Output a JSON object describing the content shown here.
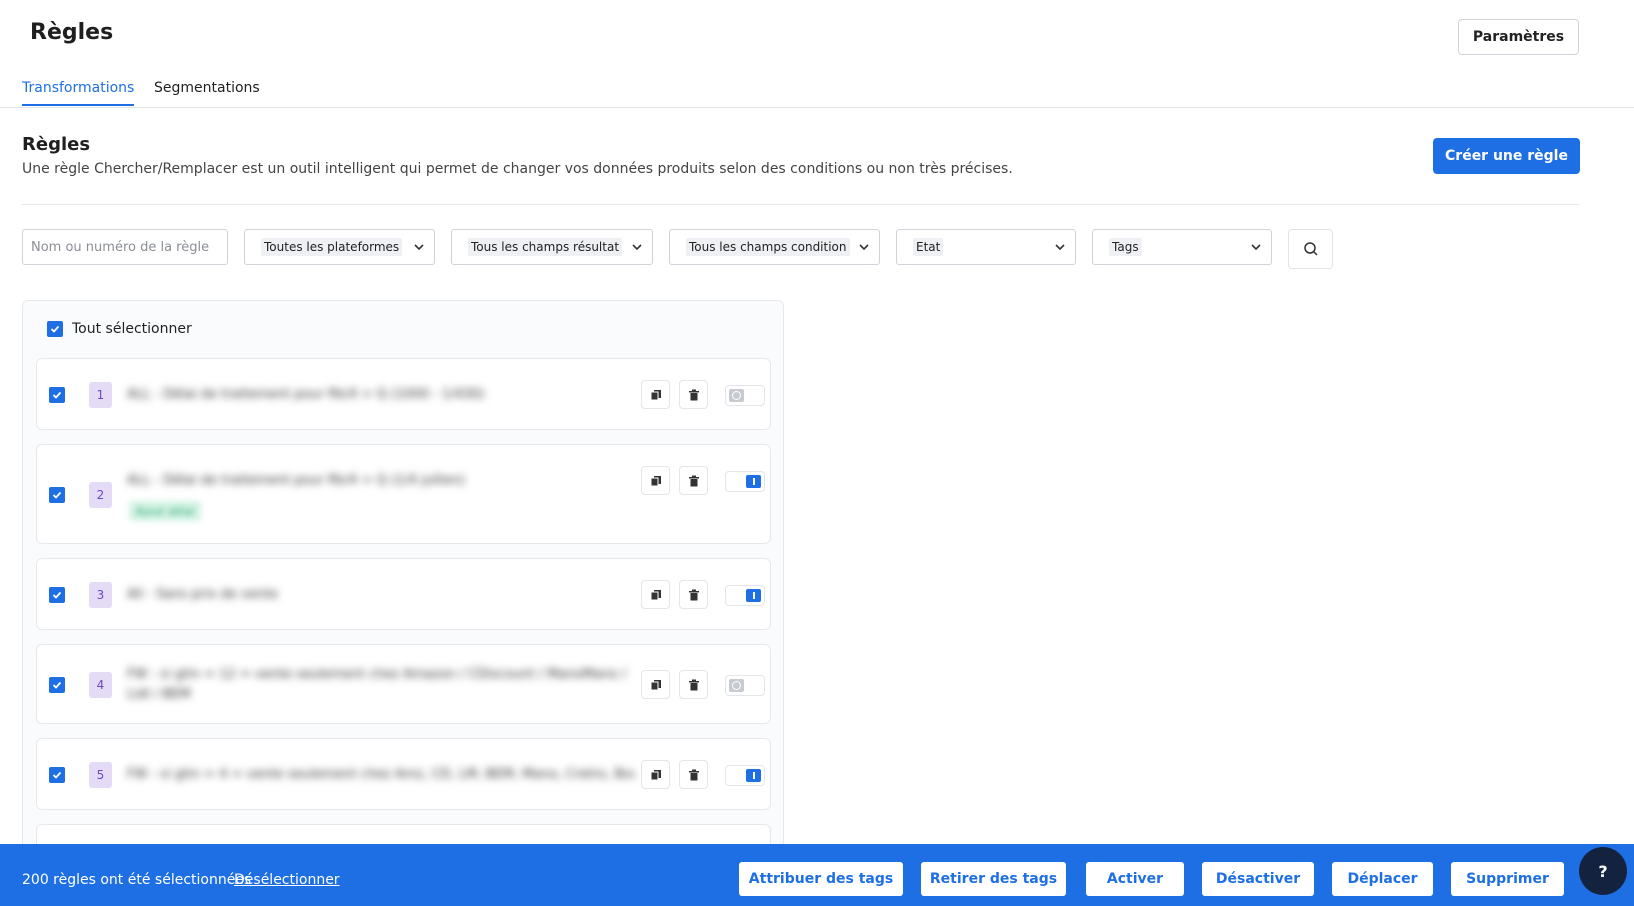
{
  "header": {
    "title": "Règles",
    "settings_label": "Paramètres"
  },
  "tabs": [
    {
      "label": "Transformations",
      "active": true
    },
    {
      "label": "Segmentations",
      "active": false
    }
  ],
  "section": {
    "title": "Règles",
    "description": "Une règle Chercher/Remplacer est un outil intelligent qui permet de changer vos données produits selon des conditions ou non très précises.",
    "create_label": "Créer une règle"
  },
  "filters": {
    "search_placeholder": "Nom ou numéro de la règle",
    "platforms": "Toutes les plateformes",
    "result_fields": "Tous les champs résultat",
    "condition_fields": "Tous les champs condition",
    "state": "Etat",
    "tags": "Tags"
  },
  "list": {
    "select_all_label": "Tout sélectionner",
    "rules": [
      {
        "number": "1",
        "name": "ALL - Délai de traitement pour Rk/4 > Q (1000 - 1/430)",
        "tag": "",
        "active": false
      },
      {
        "number": "2",
        "name": "ALL - Délai de traitement pour Rk/4 > Q (1/4 jullien)",
        "tag": "Ajout délai",
        "active": true
      },
      {
        "number": "3",
        "name": "All - Sans prix de vente",
        "tag": "",
        "active": true
      },
      {
        "number": "4",
        "name": "FW - si gtin = 12 = vente seulement chez Amazon / CDiscount / ManoMano / Lidl / BEM",
        "tag": "",
        "active": false
      },
      {
        "number": "5",
        "name": "FW - si gtin = 4 = vente seulement chez Amz, CD, LM, BEM, Mano, Cretro, Boul",
        "tag": "",
        "active": true
      }
    ]
  },
  "bottom_bar": {
    "selection_text": "200 règles ont été sélectionnées",
    "deselect_label": "Désélectionner",
    "assign_tags": "Attribuer des tags",
    "remove_tags": "Retirer des tags",
    "activate": "Activer",
    "deactivate": "Désactiver",
    "move": "Déplacer",
    "delete": "Supprimer"
  },
  "help_label": "?",
  "colors": {
    "primary": "#1e6fe4",
    "number_badge": "#e4dbf7",
    "tag_green": "#d3f3e4",
    "help_bg": "#13233f"
  }
}
